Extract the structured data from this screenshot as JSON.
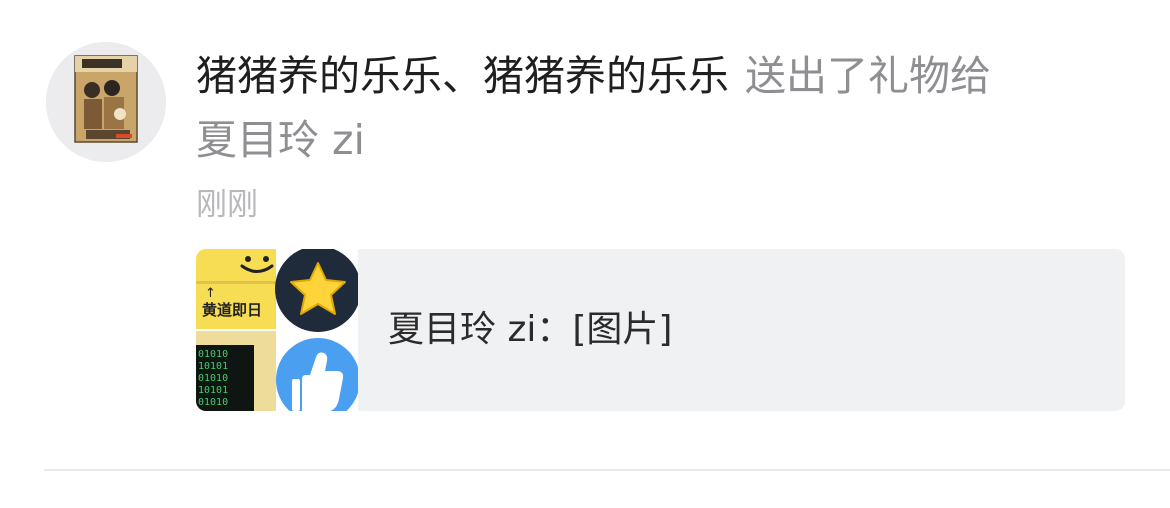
{
  "notification": {
    "actors": "猪猪养的乐乐、猪猪养的乐乐",
    "action": "送出了礼物给",
    "target": "夏目玲 zi",
    "time": "刚刚",
    "avatar": "avatar",
    "quote": {
      "text": "夏目玲 zi：[图片]",
      "thumbnail": {
        "tile_label": "黄道即日",
        "arrow": "↑",
        "binary_rows": [
          "01010",
          "10101",
          "01010",
          "10101",
          "01010"
        ],
        "icons": [
          "star-icon",
          "thumbs-up-icon",
          "smiley-icon"
        ]
      }
    }
  },
  "colors": {
    "primary_text": "#1f1f1f",
    "secondary_text": "#8e8e93",
    "time_text": "#b8b8bc",
    "card_bg": "#f0f1f3",
    "divider": "#e8e8ea"
  }
}
